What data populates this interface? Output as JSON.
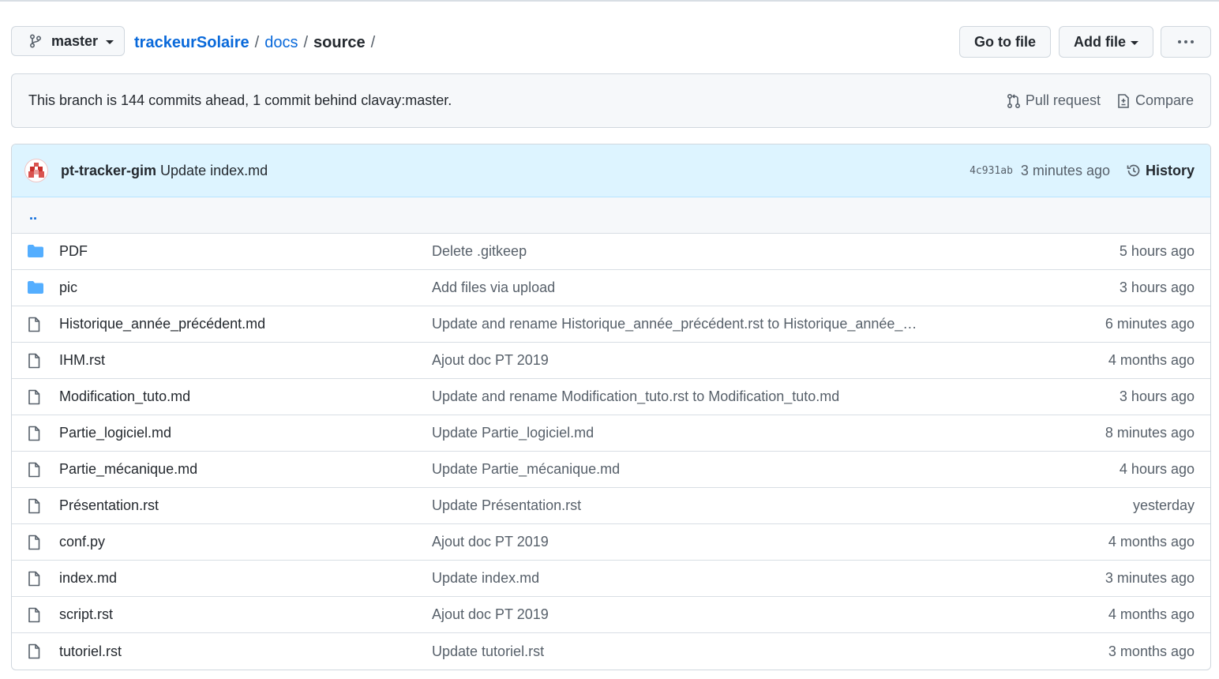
{
  "branch": {
    "label": "master",
    "icon": "git-branch-icon"
  },
  "breadcrumb": {
    "repo": "trackeurSolaire",
    "folder": "docs",
    "current": "source",
    "sep": "/"
  },
  "actions": {
    "go_to_file": "Go to file",
    "add_file": "Add file",
    "more": "more-options-icon"
  },
  "branch_info": {
    "message": "This branch is 144 commits ahead, 1 commit behind clavay:master.",
    "pull_request": "Pull request",
    "compare": "Compare"
  },
  "latest_commit": {
    "author": "pt-tracker-gim",
    "message": "Update index.md",
    "sha": "4c931ab",
    "time": "3 minutes ago",
    "history": "History"
  },
  "parent_dir": "..",
  "files": [
    {
      "type": "folder",
      "name": "PDF",
      "message": "Delete .gitkeep",
      "age": "5 hours ago"
    },
    {
      "type": "folder",
      "name": "pic",
      "message": "Add files via upload",
      "age": "3 hours ago"
    },
    {
      "type": "file",
      "name": "Historique_année_précédent.md",
      "message": "Update and rename Historique_année_précédent.rst to Historique_année_…",
      "age": "6 minutes ago"
    },
    {
      "type": "file",
      "name": "IHM.rst",
      "message": "Ajout doc PT 2019",
      "age": "4 months ago"
    },
    {
      "type": "file",
      "name": "Modification_tuto.md",
      "message": "Update and rename Modification_tuto.rst to Modification_tuto.md",
      "age": "3 hours ago"
    },
    {
      "type": "file",
      "name": "Partie_logiciel.md",
      "message": "Update Partie_logiciel.md",
      "age": "8 minutes ago"
    },
    {
      "type": "file",
      "name": "Partie_mécanique.md",
      "message": "Update Partie_mécanique.md",
      "age": "4 hours ago"
    },
    {
      "type": "file",
      "name": "Présentation.rst",
      "message": "Update Présentation.rst",
      "age": "yesterday"
    },
    {
      "type": "file",
      "name": "conf.py",
      "message": "Ajout doc PT 2019",
      "age": "4 months ago"
    },
    {
      "type": "file",
      "name": "index.md",
      "message": "Update index.md",
      "age": "3 minutes ago"
    },
    {
      "type": "file",
      "name": "script.rst",
      "message": "Ajout doc PT 2019",
      "age": "4 months ago"
    },
    {
      "type": "file",
      "name": "tutoriel.rst",
      "message": "Update tutoriel.rst",
      "age": "3 months ago"
    }
  ]
}
